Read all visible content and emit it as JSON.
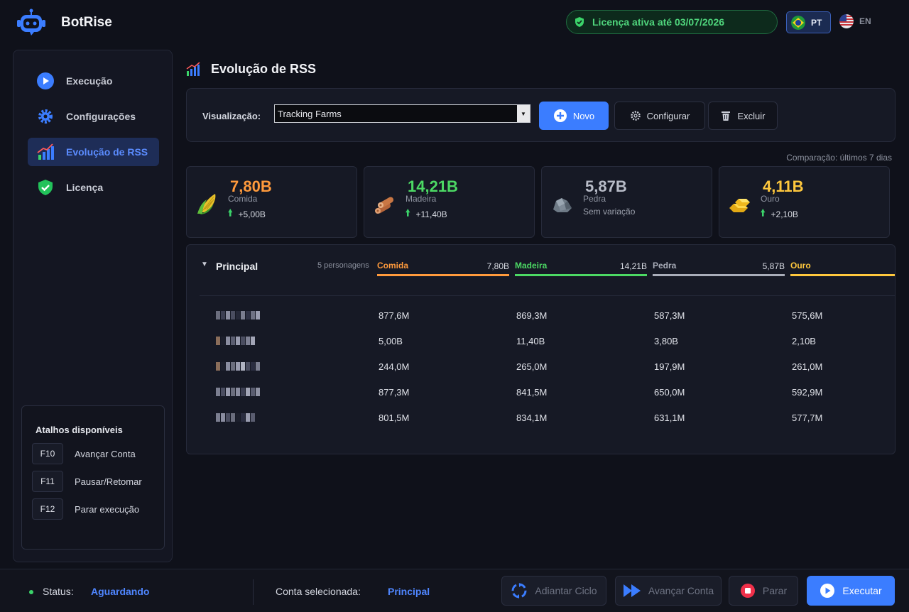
{
  "app": {
    "name": "BotRise"
  },
  "license": {
    "text": "Licença ativa até 03/07/2026"
  },
  "languages": {
    "pt": "PT",
    "en": "EN"
  },
  "sidebar": {
    "items": [
      {
        "label": "Execução"
      },
      {
        "label": "Configurações"
      },
      {
        "label": "Evolução de RSS"
      },
      {
        "label": "Licença"
      }
    ],
    "shortcuts": {
      "title": "Atalhos disponíveis",
      "items": [
        {
          "key": "F10",
          "label": "Avançar Conta"
        },
        {
          "key": "F11",
          "label": "Pausar/Retomar"
        },
        {
          "key": "F12",
          "label": "Parar execução"
        }
      ]
    }
  },
  "page": {
    "title": "Evolução de RSS"
  },
  "toolbar": {
    "view_label": "Visualização:",
    "view_value": "Tracking Farms",
    "new_label": "Novo",
    "config_label": "Configurar",
    "delete_label": "Excluir"
  },
  "comparison": "Comparação: últimos 7 dias",
  "stats": [
    {
      "value": "7,80B",
      "name": "Comida",
      "delta": "+5,00B",
      "color": "#ff9a3c"
    },
    {
      "value": "14,21B",
      "name": "Madeira",
      "delta": "+11,40B",
      "color": "#4cd964"
    },
    {
      "value": "5,87B",
      "name": "Pedra",
      "delta": "Sem variação",
      "color": "#b8bcc8"
    },
    {
      "value": "4,11B",
      "name": "Ouro",
      "delta": "+2,10B",
      "color": "#ffc83d"
    }
  ],
  "table": {
    "title": "Principal",
    "count": "5 personagens",
    "columns": [
      {
        "name": "Comida",
        "total": "7,80B",
        "color": "#ff9a3c"
      },
      {
        "name": "Madeira",
        "total": "14,21B",
        "color": "#4cd964"
      },
      {
        "name": "Pedra",
        "total": "5,87B",
        "color": "#a9adb9"
      },
      {
        "name": "Ouro",
        "total": "",
        "color": "#ffc83d"
      }
    ],
    "rows": [
      [
        "877,6M",
        "869,3M",
        "587,3M",
        "575,6M"
      ],
      [
        "5,00B",
        "11,40B",
        "3,80B",
        "2,10B"
      ],
      [
        "244,0M",
        "265,0M",
        "197,9M",
        "261,0M"
      ],
      [
        "877,3M",
        "841,5M",
        "650,0M",
        "592,9M"
      ],
      [
        "801,5M",
        "834,1M",
        "631,1M",
        "577,7M"
      ]
    ]
  },
  "footer": {
    "status_label": "Status:",
    "status_value": "Aguardando",
    "account_label": "Conta selecionada:",
    "account_value": "Principal",
    "buttons": {
      "advance_cycle": "Adiantar Ciclo",
      "advance_account": "Avançar Conta",
      "stop": "Parar",
      "run": "Executar"
    }
  }
}
